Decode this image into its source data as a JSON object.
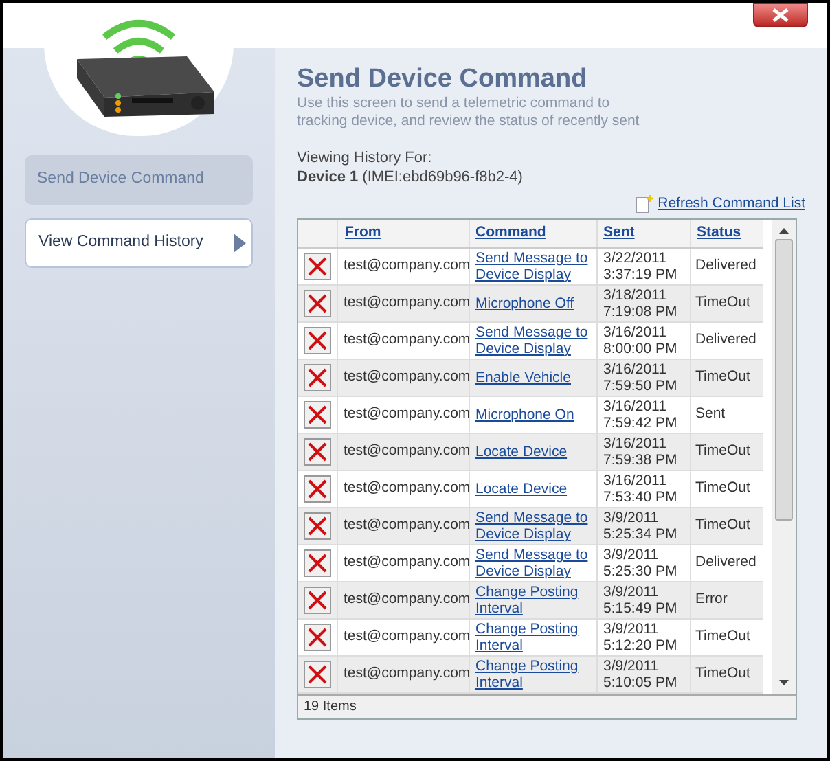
{
  "nav": [
    {
      "label": "Send Device Command",
      "selected": true
    },
    {
      "label": "View Command History",
      "selected": false
    }
  ],
  "header": {
    "title": "Send Device Command",
    "subtitle": "Use this screen to send a telemetric command to tracking device, and review the status of recently sent"
  },
  "history": {
    "label": "Viewing History For:",
    "device": "Device 1",
    "imei": "(IMEI:ebd69b96-f8b2-4)"
  },
  "refresh_link": "Refresh Command List",
  "table": {
    "columns": [
      "From",
      "Command",
      "Sent",
      "Status"
    ],
    "rows": [
      {
        "from": "test@company.com",
        "command": "Send Message to Device Display",
        "date": "3/22/2011",
        "time": "3:37:19 PM",
        "status": "Delivered"
      },
      {
        "from": "test@company.com",
        "command": "Microphone Off",
        "date": "3/18/2011",
        "time": "7:19:08 PM",
        "status": "TimeOut"
      },
      {
        "from": "test@company.com",
        "command": "Send Message to Device Display",
        "date": "3/16/2011",
        "time": "8:00:00 PM",
        "status": "Delivered"
      },
      {
        "from": "test@company.com",
        "command": "Enable Vehicle",
        "date": "3/16/2011",
        "time": "7:59:50 PM",
        "status": "TimeOut"
      },
      {
        "from": "test@company.com",
        "command": "Microphone On",
        "date": "3/16/2011",
        "time": "7:59:42 PM",
        "status": "Sent"
      },
      {
        "from": "test@company.com",
        "command": "Locate Device",
        "date": "3/16/2011",
        "time": "7:59:38 PM",
        "status": "TimeOut"
      },
      {
        "from": "test@company.com",
        "command": "Locate Device",
        "date": "3/16/2011",
        "time": "7:53:40 PM",
        "status": "TimeOut"
      },
      {
        "from": "test@company.com",
        "command": "Send Message to Device Display",
        "date": "3/9/2011",
        "time": "5:25:34 PM",
        "status": "TimeOut"
      },
      {
        "from": "test@company.com",
        "command": "Send Message to Device Display",
        "date": "3/9/2011",
        "time": "5:25:30 PM",
        "status": "Delivered"
      },
      {
        "from": "test@company.com",
        "command": "Change Posting Interval",
        "date": "3/9/2011",
        "time": "5:15:49 PM",
        "status": "Error"
      },
      {
        "from": "test@company.com",
        "command": "Change Posting Interval",
        "date": "3/9/2011",
        "time": "5:12:20 PM",
        "status": "TimeOut"
      },
      {
        "from": "test@company.com",
        "command": "Change Posting Interval",
        "date": "3/9/2011",
        "time": "5:10:05 PM",
        "status": "TimeOut"
      }
    ],
    "footer": "19 Items"
  }
}
